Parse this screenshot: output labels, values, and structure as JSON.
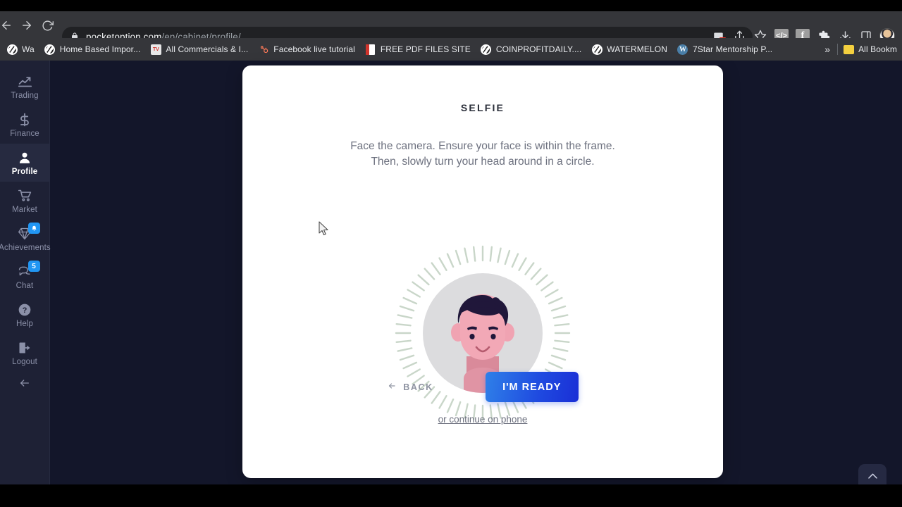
{
  "browser": {
    "nav": {
      "back": "back-arrow",
      "forward": "forward-arrow",
      "reload": "reload"
    },
    "url": {
      "host": "pocketoption.com",
      "path": "/en/cabinet/profile/",
      "lock": "lock-icon"
    },
    "toolbar_icons": [
      {
        "name": "cast-icon",
        "glyph": ""
      },
      {
        "name": "share-icon",
        "glyph": ""
      },
      {
        "name": "bookmark-star-icon",
        "glyph": ""
      },
      {
        "name": "code-extension-icon",
        "glyph": "</>"
      },
      {
        "name": "facebook-extension-icon",
        "glyph": "f"
      },
      {
        "name": "extensions-puzzle-icon",
        "glyph": ""
      },
      {
        "name": "downloads-icon",
        "glyph": ""
      },
      {
        "name": "side-panel-icon",
        "glyph": ""
      },
      {
        "name": "profile-avatar",
        "glyph": ""
      }
    ],
    "bookmarks": [
      {
        "label": "Wa",
        "favicon": "globe"
      },
      {
        "label": "Home Based Impor...",
        "favicon": "globe"
      },
      {
        "label": "All Commercials & I...",
        "favicon": "tv"
      },
      {
        "label": "Facebook live tutorial",
        "favicon": "hub"
      },
      {
        "label": "FREE PDF FILES SITE",
        "favicon": "pdf"
      },
      {
        "label": "COINPROFITDAILY....",
        "favicon": "globe"
      },
      {
        "label": "WATERMELON",
        "favicon": "globe"
      },
      {
        "label": "7Star Mentorship P...",
        "favicon": "wordpress"
      }
    ],
    "overflow_label": "»",
    "all_bookmarks_label": "All Bookm"
  },
  "sidebar": {
    "items": [
      {
        "label": "Trading",
        "icon": "chart-line-icon",
        "active": false,
        "badge": null
      },
      {
        "label": "Finance",
        "icon": "dollar-icon",
        "active": false,
        "badge": null
      },
      {
        "label": "Profile",
        "icon": "user-icon",
        "active": true,
        "badge": null
      },
      {
        "label": "Market",
        "icon": "cart-icon",
        "active": false,
        "badge": null
      },
      {
        "label": "Achievements",
        "icon": "diamond-icon",
        "active": false,
        "badge": "bell"
      },
      {
        "label": "Chat",
        "icon": "chat-bubbles-icon",
        "active": false,
        "badge": "5"
      },
      {
        "label": "Help",
        "icon": "question-circle-icon",
        "active": false,
        "badge": null
      },
      {
        "label": "Logout",
        "icon": "logout-icon",
        "active": false,
        "badge": null
      }
    ],
    "collapse_icon": "left-arrow-icon"
  },
  "modal": {
    "title": "SELFIE",
    "description_line1": "Face the camera. Ensure your face is within the frame.",
    "description_line2": "Then, slowly turn your head around in a circle.",
    "illustration": "selfie-avatar-illustration",
    "back_label": "BACK",
    "ready_label": "I'M READY",
    "phone_link_label": "or continue on phone"
  },
  "scroll_top": {
    "icon": "chevron-up-icon"
  },
  "colors": {
    "page_bg": "#13162a",
    "sidebar_bg": "#1e2135",
    "sidebar_active_bg": "#262a40",
    "card_bg": "#ffffff",
    "accent_blue": "#1f4ae0",
    "badge_blue": "#2196f3",
    "muted_text": "#6d717f",
    "sunburst": "#c8d6c8"
  }
}
